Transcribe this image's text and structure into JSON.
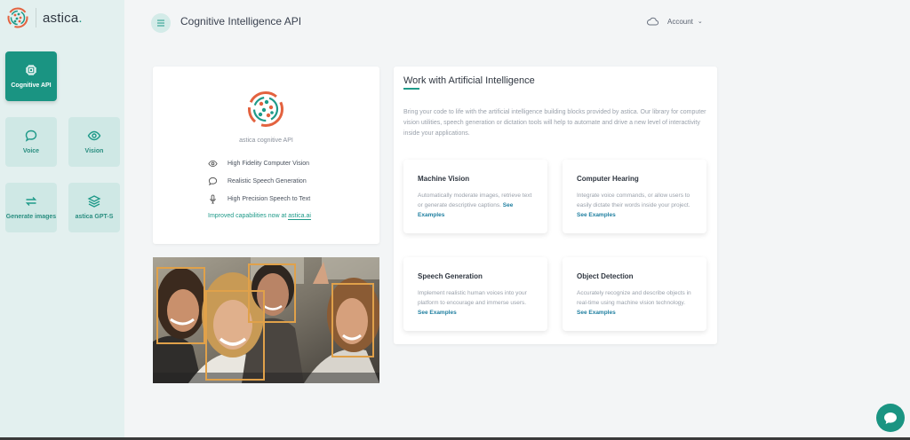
{
  "brand": {
    "name": "astica",
    "dot": "."
  },
  "sidebar": {
    "items": [
      {
        "label": "Cognitive API",
        "icon": "chip-icon"
      },
      {
        "label": "Voice",
        "icon": "chat-bubble-icon"
      },
      {
        "label": "Vision",
        "icon": "eye-icon"
      },
      {
        "label": "Generate images",
        "icon": "swap-arrows-icon"
      },
      {
        "label": "astica GPT-S",
        "icon": "layers-icon"
      }
    ]
  },
  "header": {
    "title": "Cognitive Intelligence API",
    "account_label": "Account"
  },
  "info_card": {
    "caption": "astica cognitive API",
    "features": [
      {
        "label": "High Fidelity Computer Vision",
        "icon": "eye-icon"
      },
      {
        "label": "Realistic Speech Generation",
        "icon": "speech-bubble-icon"
      },
      {
        "label": "High Precision Speech to Text",
        "icon": "microphone-icon"
      }
    ],
    "improved_prefix": "Improved capabilities now at",
    "improved_link": "astica.ai"
  },
  "main": {
    "title": "Work with Artificial Intelligence",
    "description": "Bring your code to life with the artificial intelligence building blocks provided by astica. Our library for computer vision utilities, speech generation or dictation tools will help to automate and drive a new level of interactivity inside your applications.",
    "cards": [
      {
        "title": "Machine Vision",
        "text": "Automatically moderate images, retrieve text or generate descriptive captions.",
        "link": "See Examples"
      },
      {
        "title": "Computer Hearing",
        "text": "Integrate voice commands, or allow users to easily dictate their words inside your project.",
        "link": "See Examples"
      },
      {
        "title": "Speech Generation",
        "text": "Implement realistic human voices into your platform to encourage and immerse users.",
        "link": "See Examples"
      },
      {
        "title": "Object Detection",
        "text": "Accurately recognize and describe objects in real-time using machine vision technology.",
        "link": "See Examples"
      }
    ]
  },
  "colors": {
    "accent": "#1a9482",
    "sidebar_bg": "#e3f0ef",
    "tile_bg": "#cfe8e5",
    "link": "#1f7fa0",
    "face_box": "#e0a14a"
  }
}
